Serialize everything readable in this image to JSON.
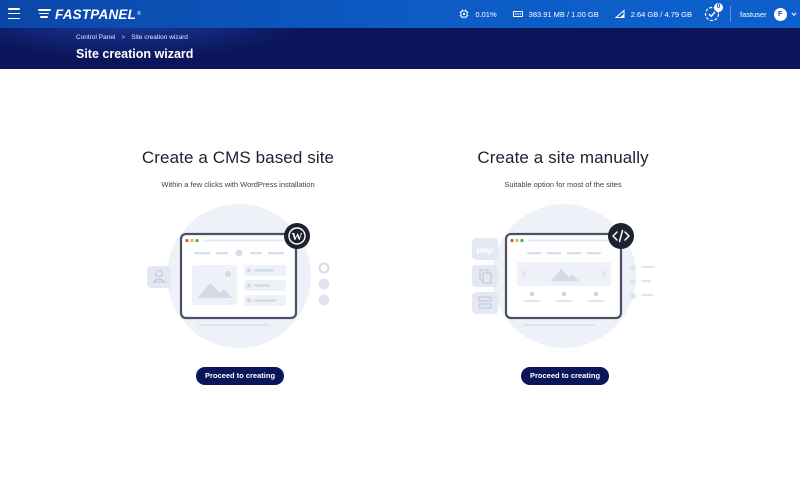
{
  "app": {
    "logo_text": "FASTPANEL",
    "logo_reg": "®"
  },
  "topbar": {
    "cpu": "0.01%",
    "ram": "383.91 MB / 1.00 GB",
    "disk": "2.64 GB / 4.79 GB",
    "notifications_count": "0",
    "username": "fastuser",
    "avatar_letter": "F"
  },
  "breadcrumb": {
    "root": "Control Panel",
    "separator": ">",
    "current": "Site creation wizard"
  },
  "page_title": "Site creation wizard",
  "cards": {
    "cms": {
      "title": "Create a CMS based site",
      "subtitle": "Within a few clicks with WordPress installation",
      "button": "Proceed to creating"
    },
    "manual": {
      "title": "Create a site manually",
      "subtitle": "Suitable option for most of the sites",
      "button": "Proceed to creating"
    }
  },
  "icons": {
    "menu": "hamburger-icon",
    "cpu": "cpu-icon",
    "ram": "ram-icon",
    "disk": "disk-icon",
    "notifications": "notification-check-icon",
    "wordpress": "wordpress-icon",
    "code": "code-icon"
  },
  "colors": {
    "topbar": "#0d5cc6",
    "header": "#0b1559",
    "button": "#0b1559",
    "illustration_bg": "#eef1f8"
  }
}
